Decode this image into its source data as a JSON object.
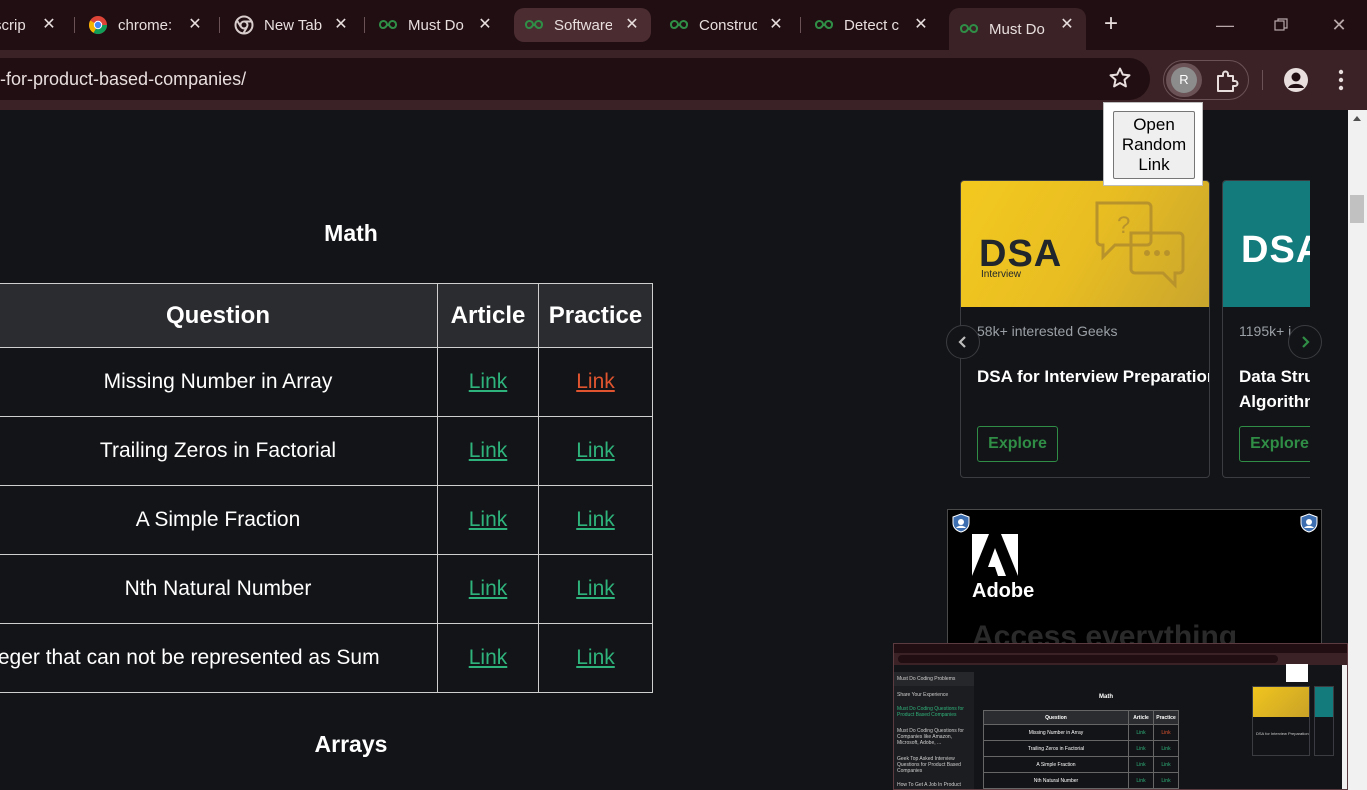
{
  "tabs": [
    {
      "title": "scrip",
      "favicon": "script-icon",
      "active": false
    },
    {
      "title": "chrome:",
      "favicon": "chrome-icon",
      "active": false
    },
    {
      "title": "New Tab",
      "favicon": "chrome-outline-icon",
      "active": false
    },
    {
      "title": "Must Do",
      "favicon": "gfg-icon",
      "active": false
    },
    {
      "title": "Software",
      "favicon": "gfg-icon",
      "active": true
    },
    {
      "title": "Construc",
      "favicon": "gfg-icon",
      "active": false
    },
    {
      "title": "Detect c",
      "favicon": "gfg-icon",
      "active": false
    },
    {
      "title": "Must Do",
      "favicon": "gfg-icon",
      "active": false
    }
  ],
  "toolbar": {
    "url": "-for-product-based-companies/",
    "extension_initial": "R"
  },
  "popup": {
    "button_label_lines": [
      "Open",
      "Random",
      "Link"
    ]
  },
  "page": {
    "section_math": "Math",
    "section_arrays": "Arrays",
    "table": {
      "headers": [
        "Question",
        "Article",
        "Practice"
      ],
      "rows": [
        {
          "question": "Missing Number in Array",
          "article": "Link",
          "practice": "Link",
          "practice_visited": true
        },
        {
          "question": "Trailing Zeros in Factorial",
          "article": "Link",
          "practice": "Link",
          "practice_visited": false
        },
        {
          "question": "A Simple Fraction",
          "article": "Link",
          "practice": "Link",
          "practice_visited": false
        },
        {
          "question": "Nth Natural Number",
          "article": "Link",
          "practice": "Link",
          "practice_visited": false
        },
        {
          "question": "e Integer that can not be represented as Sum",
          "article": "Link",
          "practice": "Link",
          "practice_visited": false
        }
      ]
    },
    "cards": [
      {
        "banner_text": "DSA",
        "banner_sub": "Interview",
        "interested": "58k+ interested Geeks",
        "title": "DSA for Interview Preparation",
        "button": "Explore"
      },
      {
        "banner_text": "DSA",
        "interested": "1195k+ i",
        "title_lines": [
          "Data Struc",
          "Algorithm"
        ],
        "button": "Explore"
      }
    ],
    "ad": {
      "brand": "Adobe",
      "headline": "Access everything"
    }
  },
  "thumbnail": {
    "side_heading": "Must Do Coding Problems",
    "side_items": [
      "Share Your Experience",
      "Must Do Coding Questions for Product Based Companies",
      "Must Do Coding Questions for Companies like Amazon, Microsoft, Adobe, ...",
      "Geek Top Asked Interview Questions for Product Based Companies",
      "How To Get A Job In Product"
    ],
    "math": "Math",
    "table_headers": [
      "Question",
      "Article",
      "Practice"
    ],
    "rows": [
      "Missing Number in Array",
      "Trailing Zeros in Factorial",
      "A Simple Fraction",
      "Nth Natural Number"
    ],
    "link": "Link",
    "card_text": "DSA for Interview Preparation"
  },
  "colors": {
    "link": "#2fb37c",
    "visited_link": "#e0552f",
    "gfg_green": "#2f8d46",
    "tabstrip": "#200e12",
    "toolbar": "#3a2226"
  }
}
